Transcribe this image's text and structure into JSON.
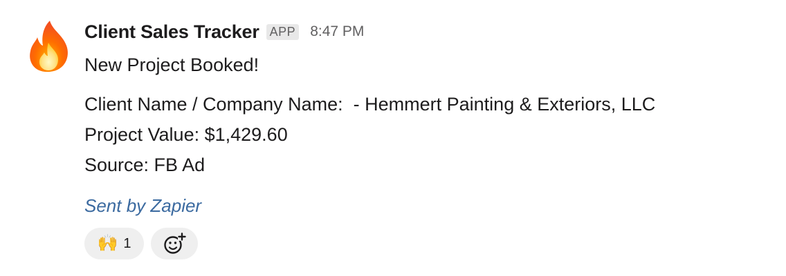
{
  "message": {
    "sender": "Client Sales Tracker",
    "badge": "APP",
    "timestamp": "8:47 PM",
    "avatar_icon": "fire-emoji-icon",
    "headline": "New Project Booked!",
    "details": [
      "Client Name / Company Name:  - Hemmert Painting & Exteriors, LLC",
      "Project Value: $1,429.60",
      "Source: FB Ad"
    ],
    "sent_by": "Sent by Zapier",
    "reactions": [
      {
        "emoji": "🙌",
        "icon": "raising-hands-icon",
        "count": "1"
      }
    ],
    "add_reaction_icon": "add-reaction-icon"
  },
  "colors": {
    "link": "#3b6aa0",
    "reaction_bg": "#efefef",
    "badge_bg": "#e8e8e8",
    "muted_text": "#616061"
  }
}
